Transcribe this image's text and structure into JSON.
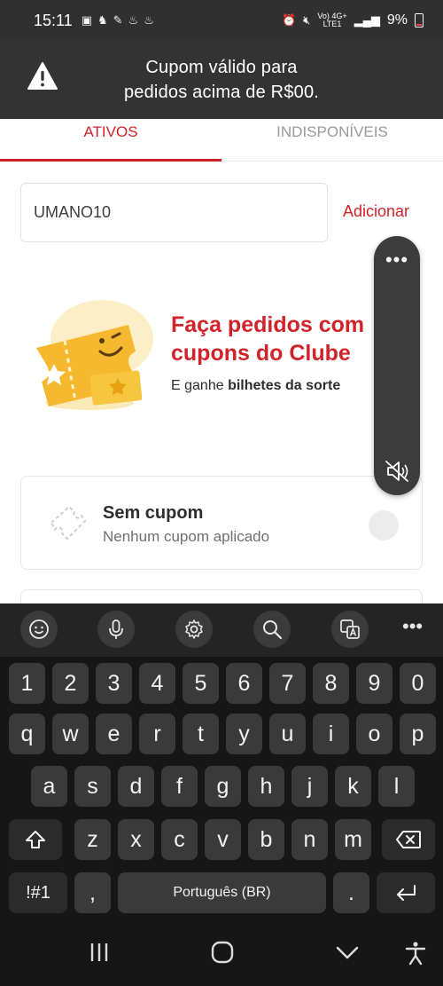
{
  "status_bar": {
    "time": "15:11",
    "network_label": "Vo) 4G+\nLTE1",
    "battery": "9%"
  },
  "toast": {
    "line1": "Cupom válido para",
    "line2": "pedidos acima de R$00."
  },
  "tabs": [
    {
      "label": "ATIVOS",
      "active": true
    },
    {
      "label": "INDISPONÍVEIS",
      "active": false
    }
  ],
  "coupon_form": {
    "value": "UMANO10",
    "add_label": "Adicionar"
  },
  "promo": {
    "title_line1": "Faça pedidos com",
    "title_line2": "cupons do Clube",
    "subtitle_prefix": "E ganhe ",
    "subtitle_bold": "bilhetes da sorte"
  },
  "no_coupon": {
    "title": "Sem cupom",
    "subtitle": "Nenhum cupom aplicado"
  },
  "keyboard": {
    "row_numbers": [
      "1",
      "2",
      "3",
      "4",
      "5",
      "6",
      "7",
      "8",
      "9",
      "0"
    ],
    "row_top": [
      "q",
      "w",
      "e",
      "r",
      "t",
      "y",
      "u",
      "i",
      "o",
      "p"
    ],
    "row_mid": [
      "a",
      "s",
      "d",
      "f",
      "g",
      "h",
      "j",
      "k",
      "l"
    ],
    "row_bottom": [
      "z",
      "x",
      "c",
      "v",
      "b",
      "n",
      "m"
    ],
    "symbols": "!#1",
    "comma": ",",
    "space": "Português (BR)",
    "period": "."
  },
  "colors": {
    "brand_red": "#d1232a"
  }
}
